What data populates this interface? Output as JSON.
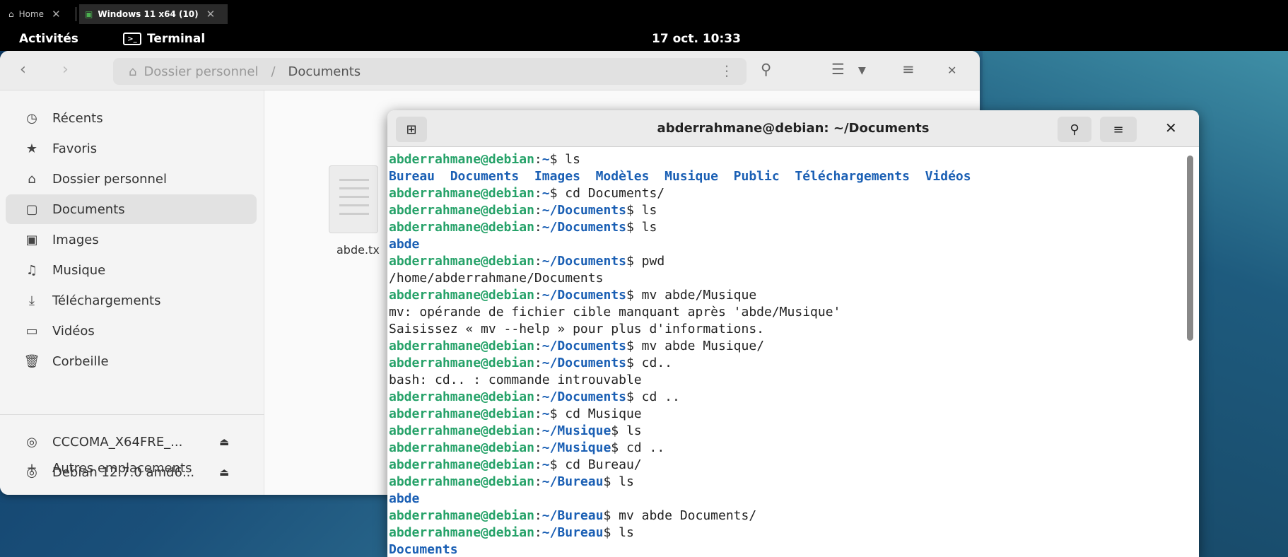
{
  "vm_tabs": {
    "home": "Home",
    "active": "Windows 11 x64 (10)"
  },
  "topbar": {
    "activities": "Activités",
    "app_name": "Terminal",
    "clock": "17 oct. 10:33"
  },
  "files": {
    "path": {
      "home": "Dossier personnel",
      "separator": "/",
      "current": "Documents"
    },
    "sidebar": [
      {
        "label": "Récents",
        "icon": "clock-icon"
      },
      {
        "label": "Favoris",
        "icon": "star-icon"
      },
      {
        "label": "Dossier personnel",
        "icon": "home-icon"
      },
      {
        "label": "Documents",
        "icon": "document-icon"
      },
      {
        "label": "Images",
        "icon": "image-icon"
      },
      {
        "label": "Musique",
        "icon": "music-icon"
      },
      {
        "label": "Téléchargements",
        "icon": "download-icon"
      },
      {
        "label": "Vidéos",
        "icon": "video-icon"
      },
      {
        "label": "Corbeille",
        "icon": "trash-icon"
      },
      {
        "label": "CCCOMA_X64FRE_...",
        "icon": "disc-icon"
      },
      {
        "label": "Debian 12.7.0 amd6...",
        "icon": "disc-icon"
      },
      {
        "label": "Autres emplacements",
        "icon": "plus-icon"
      }
    ],
    "file": {
      "name": "abde.tx"
    }
  },
  "terminal": {
    "title": "abderrahmane@debian: ~/Documents",
    "user": "abderrahmane@debian",
    "lines": [
      {
        "type": "prompt",
        "path": "~",
        "cmd": "ls"
      },
      {
        "type": "dirs",
        "text": "Bureau  Documents  Images  Modèles  Musique  Public  Téléchargements  Vidéos"
      },
      {
        "type": "prompt",
        "path": "~",
        "cmd": "cd Documents/"
      },
      {
        "type": "prompt",
        "path": "~/Documents",
        "cmd": "ls"
      },
      {
        "type": "prompt",
        "path": "~/Documents",
        "cmd": "ls"
      },
      {
        "type": "dirs",
        "text": "abde"
      },
      {
        "type": "prompt",
        "path": "~/Documents",
        "cmd": "pwd"
      },
      {
        "type": "out",
        "text": "/home/abderrahmane/Documents"
      },
      {
        "type": "prompt",
        "path": "~/Documents",
        "cmd": "mv abde/Musique"
      },
      {
        "type": "out",
        "text": "mv: opérande de fichier cible manquant après 'abde/Musique'"
      },
      {
        "type": "out",
        "text": "Saisissez « mv --help » pour plus d'informations."
      },
      {
        "type": "prompt",
        "path": "~/Documents",
        "cmd": "mv abde Musique/"
      },
      {
        "type": "prompt",
        "path": "~/Documents",
        "cmd": "cd.."
      },
      {
        "type": "out",
        "text": "bash: cd.. : commande introuvable"
      },
      {
        "type": "prompt",
        "path": "~/Documents",
        "cmd": "cd .."
      },
      {
        "type": "prompt",
        "path": "~",
        "cmd": "cd Musique"
      },
      {
        "type": "prompt",
        "path": "~/Musique",
        "cmd": "ls"
      },
      {
        "type": "prompt",
        "path": "~/Musique",
        "cmd": "cd .."
      },
      {
        "type": "prompt",
        "path": "~",
        "cmd": "cd Bureau/"
      },
      {
        "type": "prompt",
        "path": "~/Bureau",
        "cmd": "ls"
      },
      {
        "type": "dirs",
        "text": "abde"
      },
      {
        "type": "prompt",
        "path": "~/Bureau",
        "cmd": "mv abde Documents/"
      },
      {
        "type": "prompt",
        "path": "~/Bureau",
        "cmd": "ls"
      },
      {
        "type": "dirs",
        "text": "Documents"
      }
    ]
  },
  "colors": {
    "prompt_user": "#26a269",
    "prompt_path": "#1a5fb4",
    "accent": "#1a5fb4"
  }
}
